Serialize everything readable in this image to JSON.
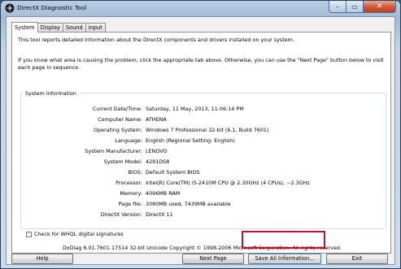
{
  "window": {
    "title": "DirectX Diagnostic Tool"
  },
  "tabs": [
    {
      "label": "System",
      "active": true
    },
    {
      "label": "Display",
      "active": false
    },
    {
      "label": "Sound",
      "active": false
    },
    {
      "label": "Input",
      "active": false
    }
  ],
  "intro_text": "This tool reports detailed information about the DirectX components and drivers installed on your system.",
  "help_text": "If you know what area is causing the problem, click the appropriate tab above.  Otherwise, you can use the \"Next Page\" button below to visit each page in sequence.",
  "system_info": {
    "title": "System Information",
    "rows": [
      {
        "label": "Current Date/Time:",
        "value": "Saturday, 11 May, 2013, 11:06:14 PM"
      },
      {
        "label": "Computer Name:",
        "value": "ATHENA"
      },
      {
        "label": "Operating System:",
        "value": "Windows 7 Professional 32-bit (6.1, Build 7601)"
      },
      {
        "label": "Language:",
        "value": "English (Regional Setting: English)"
      },
      {
        "label": "System Manufacturer:",
        "value": "LENOVO"
      },
      {
        "label": "System Model:",
        "value": "4291DS8"
      },
      {
        "label": "BIOS:",
        "value": "Default System BIOS"
      },
      {
        "label": "Processor:",
        "value": "Intel(R) Core(TM) i5-2410M CPU @ 2.30GHz (4 CPUs), ~2.3GHz"
      },
      {
        "label": "Memory:",
        "value": "4096MB RAM"
      },
      {
        "label": "Page file:",
        "value": "3080MB used, 7439MB available"
      },
      {
        "label": "DirectX Version:",
        "value": "DirectX 11"
      }
    ]
  },
  "whql_checkbox": {
    "label": "Check for WHQL digital signatures",
    "checked": false
  },
  "copyright": "DxDiag 6.01.7601.17514 32-bit Unicode  Copyright © 1998-2006 Microsoft Corporation.  All rights reserved.",
  "buttons": {
    "help": "Help",
    "next_page": "Next Page",
    "save_all": "Save All Information...",
    "exit": "Exit"
  },
  "colors": {
    "highlight": "#c8102e",
    "titlebar": "#b7cde2"
  }
}
